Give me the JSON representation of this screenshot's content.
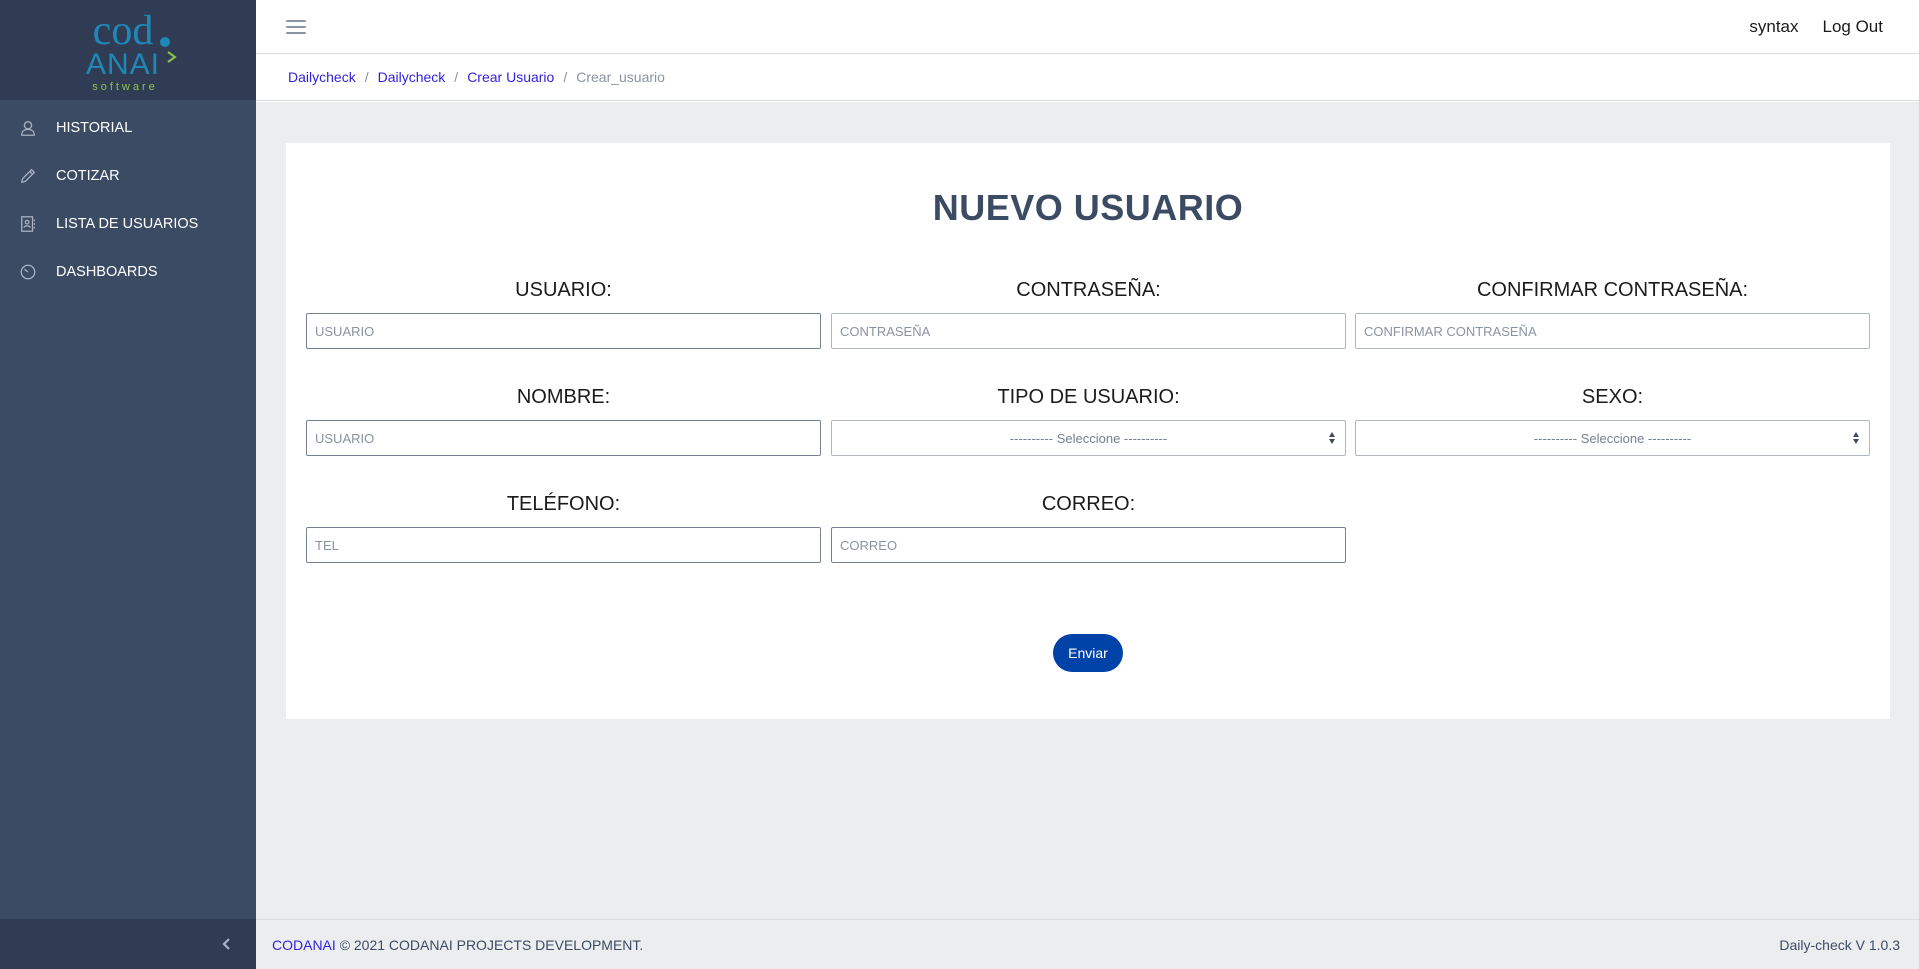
{
  "brand": {
    "logo_word_top": "cod",
    "logo_word_bottom": "ANAI",
    "logo_tagline": "software",
    "colors": {
      "primary": "#1e88b8",
      "accent": "#8bc34a"
    }
  },
  "sidebar": {
    "items": [
      {
        "label": "HISTORIAL",
        "icon": "user-icon"
      },
      {
        "label": "COTIZAR",
        "icon": "pencil-icon"
      },
      {
        "label": "LISTA DE USUARIOS",
        "icon": "contact-list-icon"
      },
      {
        "label": "DASHBOARDS",
        "icon": "speedometer-icon"
      }
    ],
    "toggler_icon": "chevron-left-icon"
  },
  "header": {
    "menu_icon": "hamburger-icon",
    "user": "syntax",
    "logout": "Log Out"
  },
  "breadcrumb": [
    "Dailycheck",
    "Dailycheck",
    "Crear Usuario",
    "Crear_usuario"
  ],
  "form": {
    "title": "NUEVO USUARIO",
    "fields": {
      "usuario": {
        "label": "USUARIO:",
        "placeholder": "USUARIO"
      },
      "contrasena": {
        "label": "CONTRASEÑA:",
        "placeholder": "CONTRASEÑA"
      },
      "confirmar": {
        "label": "CONFIRMAR CONTRASEÑA:",
        "placeholder": "CONFIRMAR CONTRASEÑA"
      },
      "nombre": {
        "label": "NOMBRE:",
        "placeholder": "USUARIO"
      },
      "tipo": {
        "label": "TIPO DE USUARIO:",
        "value": "---------- Seleccione ----------"
      },
      "sexo": {
        "label": "SEXO:",
        "value": "---------- Seleccione ----------"
      },
      "telefono": {
        "label": "TELÉFONO:",
        "placeholder": "TEL"
      },
      "correo": {
        "label": "CORREO:",
        "placeholder": "CORREO"
      }
    },
    "submit": "Enviar"
  },
  "footer": {
    "link": "CODANAI",
    "copyright": "© 2021 CODANAI PROJECTS DEVELOPMENT.",
    "version": "Daily-check V 1.0.3"
  },
  "colors": {
    "sidebar_bg": "#3c4b64",
    "sidebar_brand_bg": "#303c54",
    "page_bg": "#ebedef",
    "link": "#321fdb",
    "button": "#0043a8"
  }
}
